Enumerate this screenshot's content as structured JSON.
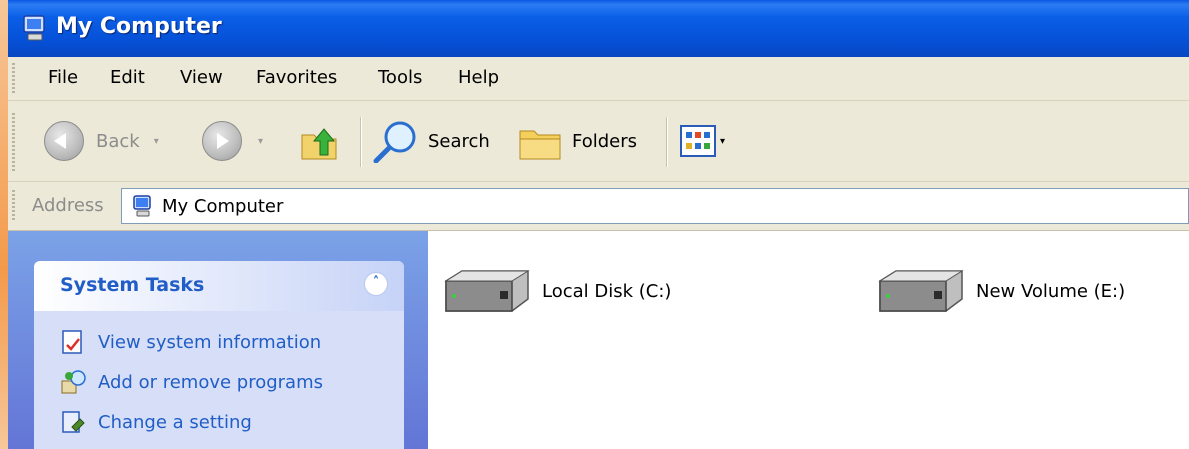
{
  "window": {
    "title": "My Computer",
    "icon": "my-computer-icon"
  },
  "menu": {
    "items": [
      "File",
      "Edit",
      "View",
      "Favorites",
      "Tools",
      "Help"
    ]
  },
  "toolbar": {
    "back_label": "Back",
    "search_label": "Search",
    "folders_label": "Folders"
  },
  "address": {
    "label": "Address",
    "value": "My Computer"
  },
  "system_tasks": {
    "title": "System Tasks",
    "collapse_glyph": "˄",
    "links": [
      {
        "label": "View system information",
        "icon": "system-info-icon"
      },
      {
        "label": "Add or remove programs",
        "icon": "add-remove-programs-icon"
      },
      {
        "label": "Change a setting",
        "icon": "control-panel-icon"
      }
    ]
  },
  "drives": [
    {
      "label": "Local Disk (C:)",
      "icon": "hard-drive-icon"
    },
    {
      "label": "New Volume (E:)",
      "icon": "hard-drive-icon"
    }
  ],
  "colors": {
    "titlebar": "#0551d8",
    "chrome": "#ece9d8",
    "taskpane": "#6375d6",
    "link": "#215dc6"
  }
}
